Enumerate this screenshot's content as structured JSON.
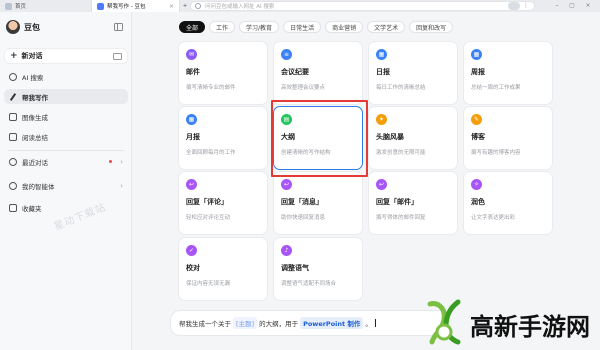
{
  "tabs": [
    {
      "label": "首页",
      "active": false
    },
    {
      "label": "帮我写作 - 豆包",
      "active": true
    }
  ],
  "address_bar": {
    "placeholder": "问问豆包或输入网址 AI 搜索"
  },
  "sidebar": {
    "brand_name": "豆包",
    "new_chat_label": "新对话",
    "items": [
      {
        "label": "AI 搜索",
        "icon": "search-ai-icon"
      },
      {
        "label": "帮我写作",
        "icon": "pen-icon",
        "active": true
      },
      {
        "label": "图像生成",
        "icon": "image-icon"
      },
      {
        "label": "阅读总结",
        "icon": "book-icon"
      }
    ],
    "items2": [
      {
        "label": "最近对话",
        "icon": "clock-icon",
        "has_dot": true
      },
      {
        "label": "我的智能体",
        "icon": "agent-icon"
      },
      {
        "label": "收藏夹",
        "icon": "bookmark-icon"
      }
    ],
    "watermark": "星动下载站"
  },
  "categories": [
    "全部",
    "工作",
    "学习/教育",
    "日常生活",
    "商业营销",
    "文学艺术",
    "回复和改写"
  ],
  "cards": [
    {
      "title": "邮件",
      "desc": "撰写清晰专业的邮件",
      "color": "#8b5cf6",
      "icon": "mail-icon"
    },
    {
      "title": "会议纪要",
      "desc": "高效整理会议要点",
      "color": "#3b82f6",
      "icon": "notes-icon"
    },
    {
      "title": "日报",
      "desc": "每日工作的清晰总结",
      "color": "#3b82f6",
      "icon": "calendar-icon"
    },
    {
      "title": "周报",
      "desc": "总结一周的工作成果",
      "color": "#3b82f6",
      "icon": "calendar-icon"
    },
    {
      "title": "月报",
      "desc": "全面回顾每月的工作",
      "color": "#3b82f6",
      "icon": "calendar-icon"
    },
    {
      "title": "大纲",
      "desc": "创建清晰的写作结构",
      "color": "#22c55e",
      "icon": "outline-icon"
    },
    {
      "title": "头脑风暴",
      "desc": "激发创意的无限可能",
      "color": "#f59e0b",
      "icon": "bulb-icon"
    },
    {
      "title": "博客",
      "desc": "撰写有趣的博客内容",
      "color": "#f59e0b",
      "icon": "blog-icon"
    },
    {
      "title": "回复「评论」",
      "desc": "轻松应对评论互动",
      "color": "#a855f7",
      "icon": "reply-icon"
    },
    {
      "title": "回复「消息」",
      "desc": "助你快速回复消息",
      "color": "#a855f7",
      "icon": "reply-icon"
    },
    {
      "title": "回复「邮件」",
      "desc": "撰写得体的邮件回复",
      "color": "#a855f7",
      "icon": "reply-icon"
    },
    {
      "title": "润色",
      "desc": "让文字表达更出彩",
      "color": "#a855f7",
      "icon": "polish-icon"
    },
    {
      "title": "校对",
      "desc": "保证内容无误无漏",
      "color": "#a855f7",
      "icon": "check-icon"
    },
    {
      "title": "调整语气",
      "desc": "调整语气适配不同场合",
      "color": "#a855f7",
      "icon": "tone-icon"
    }
  ],
  "input": {
    "prefix": "帮我生成一个关于",
    "slot1": "[主题]",
    "middle": "的大纲，用于",
    "slot2": "PowerPoint 制作",
    "suffix": "。"
  },
  "logo_text": "高新手游网"
}
